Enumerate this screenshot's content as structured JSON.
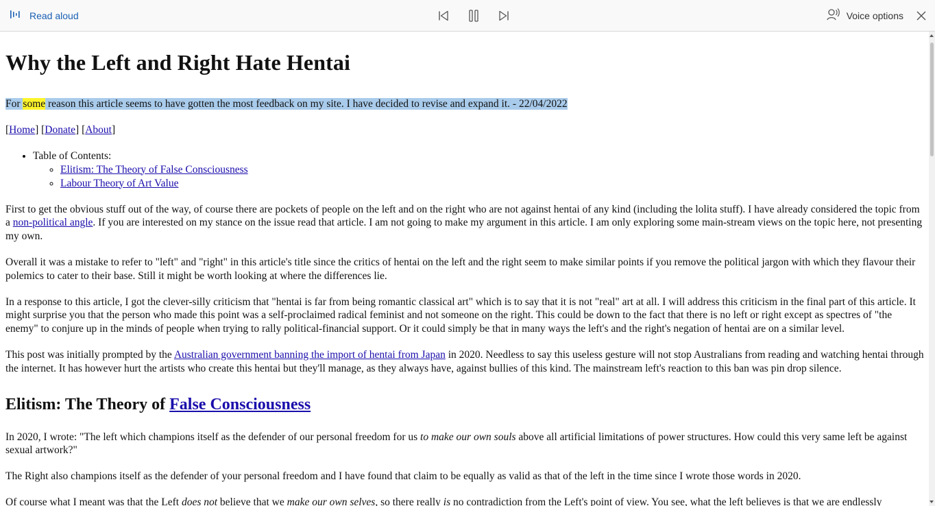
{
  "toolbar": {
    "read_aloud_label": "Read aloud",
    "voice_options_label": "Voice options"
  },
  "article": {
    "title": "Why the Left and Right Hate Hentai",
    "intro_before": "For ",
    "intro_highlighted_word": "some",
    "intro_after": " reason this article seems to have gotten the most feedback on my site. I have decided to revise and expand it. - 22/04/2022",
    "nav": {
      "home": "Home",
      "donate": "Donate",
      "about": "About"
    },
    "toc": {
      "heading": "Table of Contents:",
      "items": [
        "Elitism: The Theory of False Consciousness",
        "Labour Theory of Art Value"
      ]
    },
    "p1": {
      "before": "First to get the obvious stuff out of the way, of course there are pockets of people on the left and on the right who are not against hentai of any kind (including the lolita stuff). I have already considered the topic from a ",
      "link": "non-political angle",
      "after": ". If you are interested on my stance on the issue read that article. I am not going to make my argument in this article. I am only exploring some main-stream views on the topic here, not presenting my own."
    },
    "p2": "Overall it was a mistake to refer to \"left\" and \"right\" in this article's title since the critics of hentai on the left and the right seem to make similar points if you remove the political jargon with which they flavour their polemics to cater to their base. Still it might be worth looking at where the differences lie.",
    "p3": "In a response to this article, I got the clever-silly criticism that \"hentai is far from being romantic classical art\" which is to say that it is not \"real\" art at all. I will address this criticism in the final part of this article. It might surprise you that the person who made this point was a self-proclaimed radical feminist and not someone on the right. This could be down to the fact that there is no left or right except as spectres of \"the enemy\" to conjure up in the minds of people when trying to rally political-financial support. Or it could simply be that in many ways the left's and the right's negation of hentai are on a similar level.",
    "p4": {
      "before": "This post was initially prompted by the ",
      "link": "Australian government banning the import of hentai from Japan",
      "after": " in 2020. Needless to say this useless gesture will not stop Australians from reading and watching hentai through the internet. It has however hurt the artists who create this hentai but they'll manage, as they always have, against bullies of this kind. The mainstream left's reaction to this ban was pin drop silence."
    },
    "section1": {
      "heading_before": "Elitism: The Theory of ",
      "heading_link": "False Consciousness"
    },
    "p5": {
      "before": "In 2020, I wrote: \"The left which champions itself as the defender of our personal freedom for us ",
      "italic": "to make our own souls",
      "after": " above all artificial limitations of power structures. How could this very same left be against sexual artwork?\""
    },
    "p6": "The Right also champions itself as the defender of your personal freedom and I have found that claim to be equally as valid as that of the left in the time since I wrote those words in 2020.",
    "p7": {
      "t1": "Of course what I meant was that the Left ",
      "i1": "does not",
      "t2": " believe that we ",
      "i2": "make our own selves",
      "t3": ", so there really ",
      "i3": "is",
      "t4": " no contradiction from the Left's point of view. You see, what the left believes is that we are endlessly"
    }
  }
}
